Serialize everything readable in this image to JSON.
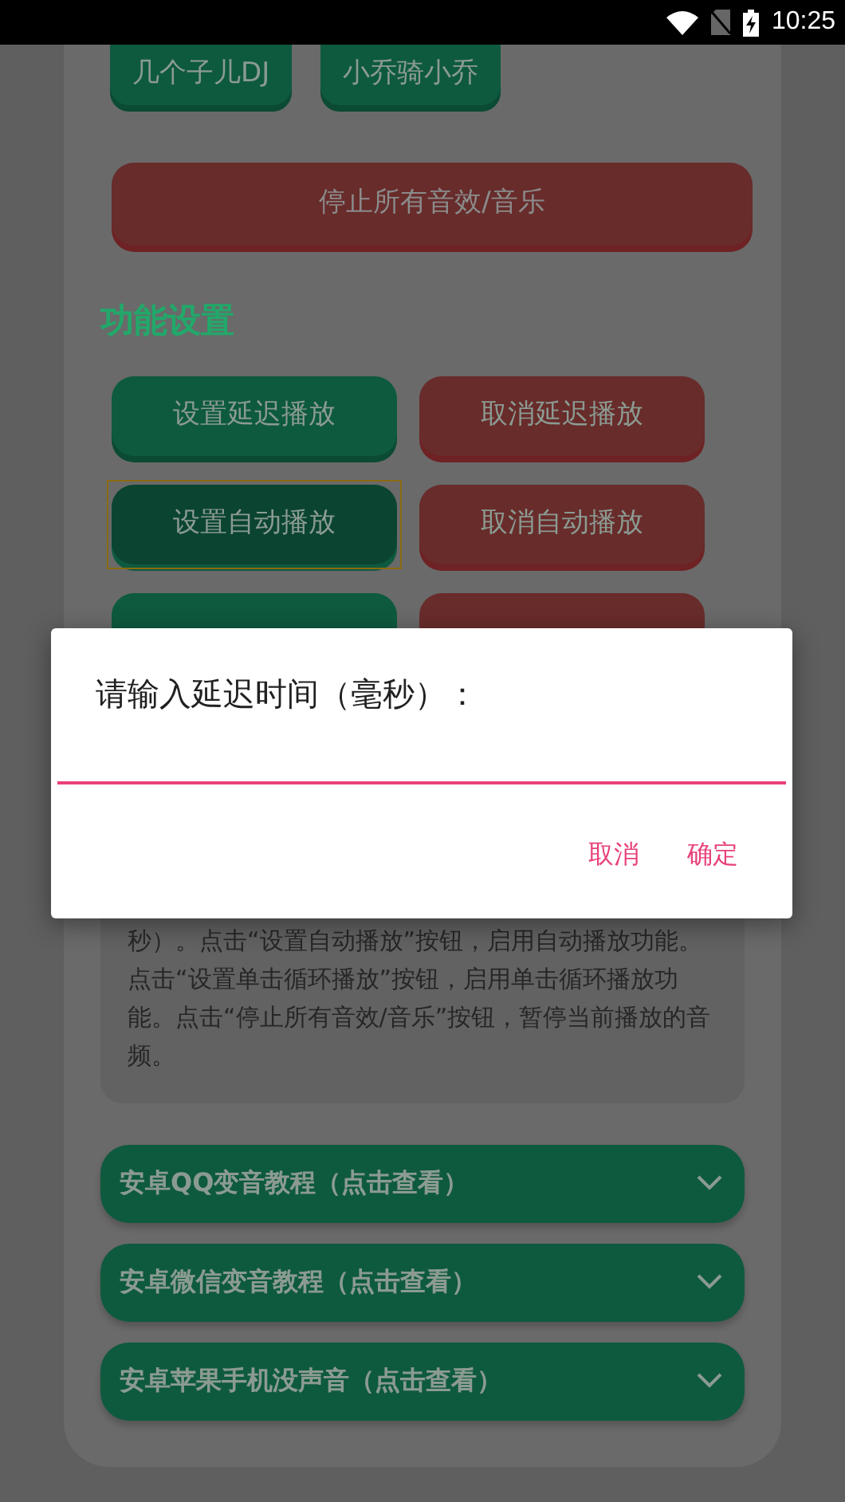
{
  "status_bar": {
    "time": "10:25"
  },
  "top_buttons": [
    {
      "label": "几个子儿DJ"
    },
    {
      "label": "小乔骑小乔"
    }
  ],
  "stop_button": {
    "label": "停止所有音效/音乐"
  },
  "section_title": "功能设置",
  "function_buttons": [
    {
      "label": "设置延迟播放",
      "kind": "set",
      "focused": false
    },
    {
      "label": "取消延迟播放",
      "kind": "cancel",
      "focused": false
    },
    {
      "label": "设置自动播放",
      "kind": "set",
      "focused": true
    },
    {
      "label": "取消自动播放",
      "kind": "cancel",
      "focused": false
    },
    {
      "kind": "set",
      "focused": false
    },
    {
      "kind": "cancel",
      "focused": false
    }
  ],
  "description": "秒）。点击“设置自动播放”按钮，启用自动播放功能。点击“设置单击循环播放”按钮，启用单击循环播放功能。点击“停止所有音效/音乐”按钮，暂停当前播放的音频。",
  "tutorials": [
    {
      "label": "安卓QQ变音教程（点击查看）",
      "expanded": false
    },
    {
      "label": "安卓微信变音教程（点击查看）",
      "expanded": false
    },
    {
      "label": "安卓苹果手机没声音（点击查看）",
      "expanded": false
    }
  ],
  "dialog": {
    "title": "请输入延迟时间（毫秒）：",
    "buttons": [
      "取消",
      "确定"
    ]
  }
}
